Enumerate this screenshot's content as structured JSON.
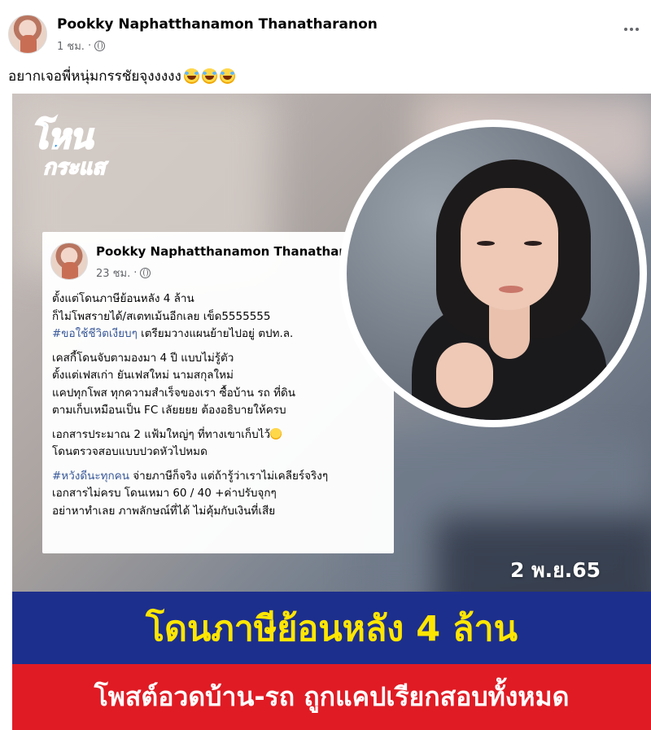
{
  "post": {
    "author": "Pookky Naphatthanamon Thanatharanon",
    "time": "1 ชม.",
    "separator": "·",
    "privacy_icon": "globe-icon",
    "more_icon": "more-options-icon",
    "caption": "อยากเจอพี่หนุ่มกรรชัยจุงงงงง"
  },
  "image": {
    "logo_top": "โหน",
    "logo_bottom": "กระแส",
    "date": "2 พ.ย.65",
    "headline_top": "โดนภาษีย้อนหลัง 4 ล้าน",
    "headline_bottom": "โพสต์อวดบ้าน-รถ ถูกแคปเรียกสอบทั้งหมด",
    "colors": {
      "banner_blue": "#1d2f8c",
      "headline_yellow": "#ffe600",
      "banner_red": "#e01b24"
    }
  },
  "inner_post": {
    "author": "Pookky Naphatthanamon Thanathar",
    "time": "23 ชม.",
    "separator": "·",
    "para1_line1": "ตั้งแต่โดนภาษีย้อนหลัง 4 ล้าน",
    "para1_line2": "ก็ไม่โพสรายได้/สเตทเม้นอีกเลย เข็ด5555555",
    "para1_hashtag": "#ขอใช้ชีวิตเงียบๆ",
    "para1_line3_rest": " เตรียมวางแผนย้ายไปอยู่ ตปท.ล.",
    "para2_line1": "เคสกี้โดนจับตามองมา 4 ปี แบบไม่รู้ตัว",
    "para2_line2": "ตั้งแต่เฟสเก่า ยันเฟสใหม่ นามสกุลใหม่",
    "para2_line3": "แคปทุกโพส ทุกความสำเร็จของเรา ซื้อบ้าน รถ ที่ดิน",
    "para2_line4": "ตามเก็บเหมือนเป็น FC เลัยยยย ต้องอธิบายให้ครบ",
    "para3_line1": "เอกสารประมาณ 2 แฟ้มใหญ่ๆ ที่ทางเขาเก็บไว้",
    "para3_line2": "โดนตรวจสอบแบบปวดหัวไปหมด",
    "para4_hashtag": "#หวังดีนะทุกคน",
    "para4_line1_rest": " จ่ายภาษีก็จริง แต่ถ้ารู้ว่าเราไม่เคลียร์จริงๆ",
    "para4_line2": "เอกสารไม่ครบ โดนเหมา 60 / 40 +ค่าปรับจุกๆ",
    "para4_line3": "อย่าหาทำเลย ภาพลักษณ์ที่ได้ ไม่คุ้มกับเงินที่เสีย"
  }
}
